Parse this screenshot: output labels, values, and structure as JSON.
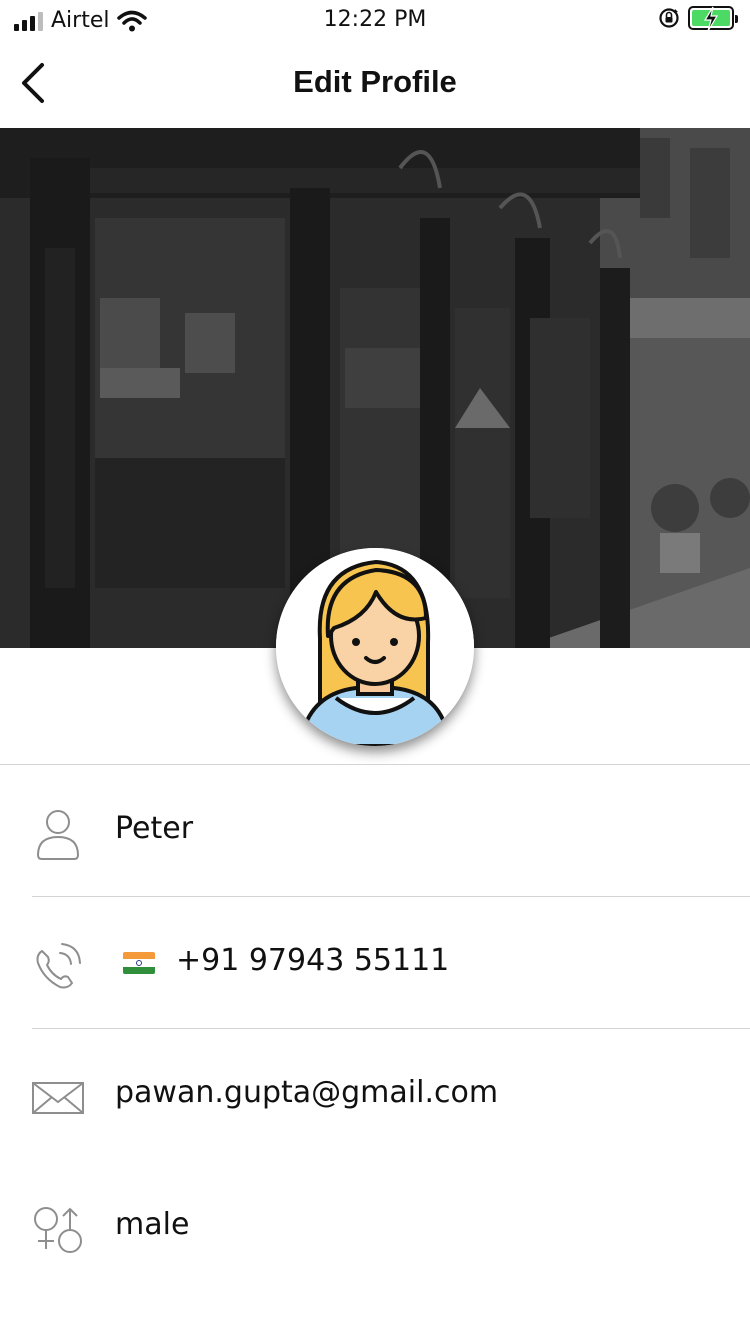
{
  "status_bar": {
    "carrier": "Airtel",
    "time": "12:22 PM"
  },
  "header": {
    "title": "Edit Profile"
  },
  "profile": {
    "name": "Peter",
    "phone": "+91 97943 55111",
    "email": "pawan.gupta@gmail.com",
    "gender": "male"
  },
  "icons": {
    "back": "chevron-left-icon",
    "name": "user-icon",
    "phone": "phone-call-icon",
    "email": "envelope-icon",
    "gender": "gender-icon",
    "flag": "india-flag-icon"
  },
  "colors": {
    "divider": "#d4d4d4",
    "icon_gray": "#8e8e8e",
    "battery_green": "#4cd964"
  }
}
